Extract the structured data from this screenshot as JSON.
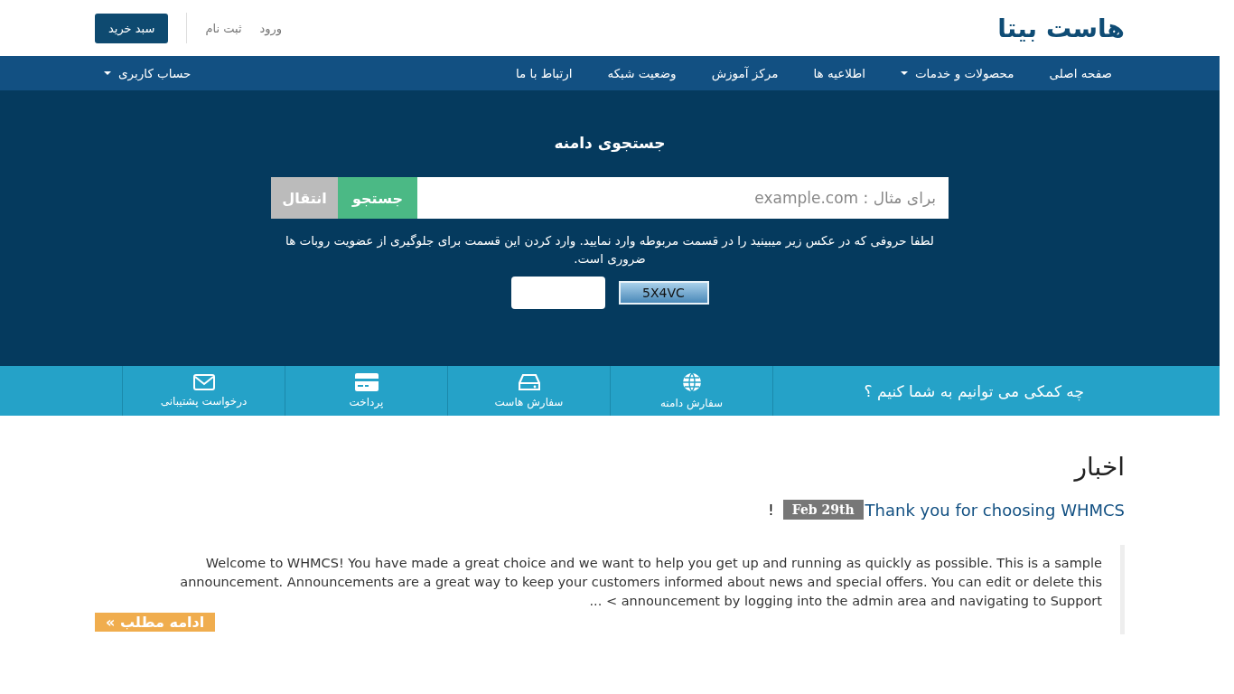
{
  "header": {
    "logo": "هاست بیتا",
    "links": [
      "ورود",
      "ثبت نام"
    ],
    "cart_button": "سبد خرید"
  },
  "nav": {
    "items": [
      {
        "label": "صفحه اصلی",
        "dropdown": false
      },
      {
        "label": "محصولات و خدمات",
        "dropdown": true
      },
      {
        "label": "اطلاعیه ها",
        "dropdown": false
      },
      {
        "label": "مرکز آموزش",
        "dropdown": false
      },
      {
        "label": "وضعیت شبکه",
        "dropdown": false
      },
      {
        "label": "ارتباط با ما",
        "dropdown": false
      }
    ],
    "account": {
      "label": "حساب کاربری",
      "dropdown": true
    }
  },
  "domain_search": {
    "title": "جستجوی دامنه",
    "placeholder": "برای مثال : example.com",
    "search_button": "جستجو",
    "transfer_button": "انتقال",
    "captcha_note": "لطفا حروفی که در عکس زیر میبینید را در قسمت مربوطه وارد نمایید. وارد کردن این قسمت برای جلوگیری از عضویت روبات ها ضروری است.",
    "captcha_code": "5X4VC"
  },
  "help_bar": {
    "title": "چه کمکی می توانیم به شما کنیم ؟",
    "items": [
      {
        "kind": "globe",
        "label": "سفارش دامنه"
      },
      {
        "kind": "drive",
        "label": "سفارش هاست"
      },
      {
        "kind": "card",
        "label": "پرداخت"
      },
      {
        "kind": "envelope",
        "label": "درخواست پشتیبانی"
      }
    ]
  },
  "news": {
    "heading": "اخبار",
    "announcements": [
      {
        "title": "Thank you for choosing WHMCS",
        "date": "Feb 29th",
        "suffix": "!",
        "body": "Welcome to WHMCS! You have made a great choice and we want to help you get up and running as quickly as possible. This is a sample announcement. Announcements are a great way to keep your customers informed about news and special offers. You can edit or delete this announcement by logging into the admin area and navigating to Support > ...",
        "more_button": "ادامه مطلب »"
      }
    ]
  }
}
